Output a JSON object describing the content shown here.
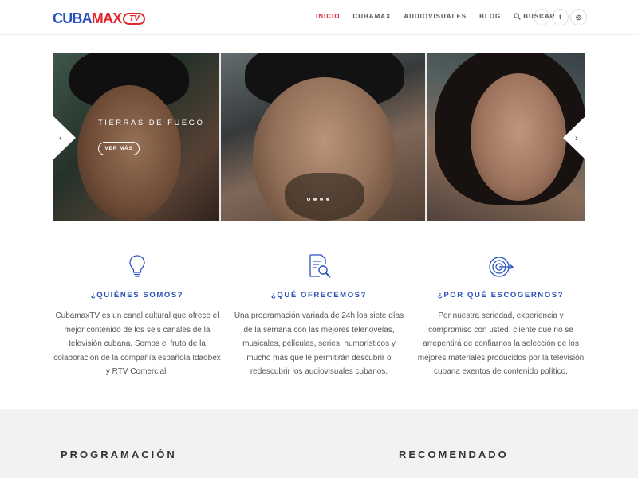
{
  "brand": {
    "logo_part1": "CUBA",
    "logo_part2": "MAX",
    "logo_part3": "TV",
    "color_blue": "#2a52be",
    "color_red": "#e2262c"
  },
  "nav": {
    "items": [
      {
        "label": "INICIO",
        "active": true
      },
      {
        "label": "CUBAMAX",
        "active": false
      },
      {
        "label": "AUDIOVISUALES",
        "active": false
      },
      {
        "label": "BLOG",
        "active": false
      }
    ],
    "search_label": "BUSCAR",
    "search_icon": "search-icon"
  },
  "social": [
    {
      "icon": "facebook-icon",
      "glyph": "f"
    },
    {
      "icon": "twitter-icon",
      "glyph": "t"
    },
    {
      "icon": "instagram-icon",
      "glyph": "◎"
    }
  ],
  "slider": {
    "title": "TIERRAS DE FUEGO",
    "button_label": "VER MÁS",
    "prev_glyph": "‹",
    "next_glyph": "›",
    "dots_count": 4,
    "active_dot": 0
  },
  "features": [
    {
      "icon": "lightbulb-icon",
      "title": "¿QUIÉNES SOMOS?",
      "lines": [
        "CubamaxTV es un canal cultural que ofrece el",
        "mejor contenido de los seis canales de la",
        "televisión cubana. Somos el fruto de la",
        "colaboración de la compañía española Idaobex",
        "y RTV Comercial."
      ]
    },
    {
      "icon": "document-search-icon",
      "title": "¿QUÉ OFRECEMOS?",
      "lines": [
        "Una programación variada de 24h los siete días",
        "de la semana con las mejores telenovelas,",
        "musicales, películas, series, humorísticos y",
        "mucho más que le permitirán descubrir o",
        "redescubrir los audiovisuales cubanos."
      ]
    },
    {
      "icon": "target-icon",
      "title": "¿POR QUÉ ESCOGERNOS?",
      "lines": [
        "Por nuestra seriedad, experiencia y",
        "compromiso con usted, cliente que no se",
        "arrepentirá de confiarnos la selección de los",
        "mejores materiales producidos por la televisión",
        "cubana exentos de contenido político."
      ]
    }
  ],
  "sections": {
    "programacion": "PROGRAMACIÓN",
    "recomendado": "RECOMENDADO"
  }
}
